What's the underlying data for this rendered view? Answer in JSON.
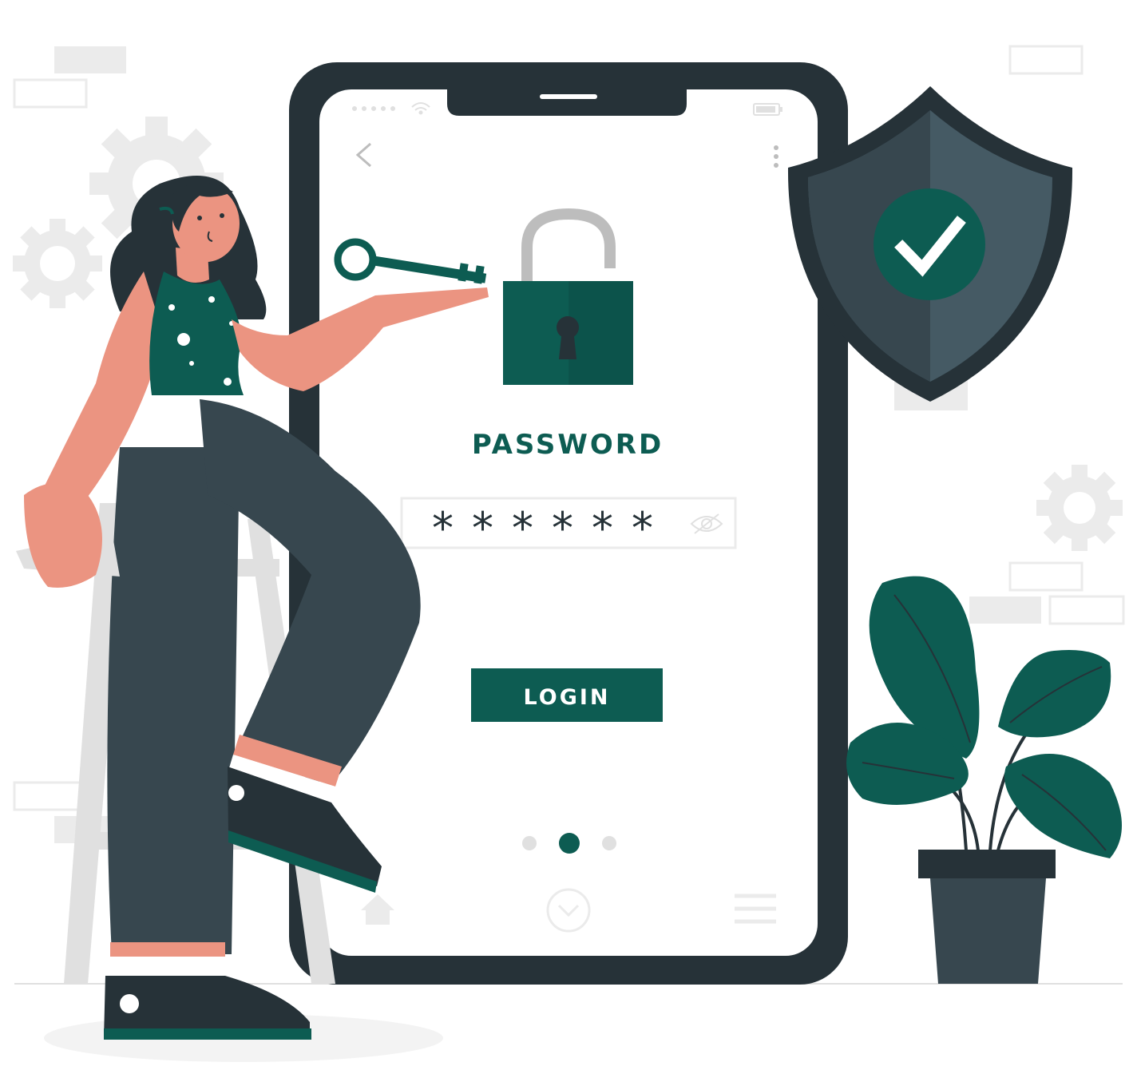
{
  "screen": {
    "title": "PASSWORD",
    "password_value": "******",
    "login_label": "LOGIN"
  },
  "pagination": {
    "total": 3,
    "active": 2
  },
  "icons": {
    "back": "chevron-left-icon",
    "menu": "more-vertical-icon",
    "reveal": "eye-slash-icon",
    "home": "home-icon",
    "nav_center": "chevron-down-circle-icon",
    "nav_menu": "hamburger-icon",
    "wifi": "wifi-icon",
    "battery": "battery-icon",
    "lock": "unlocked-padlock-icon",
    "key": "key-icon",
    "shield": "shield-check-icon"
  },
  "colors": {
    "accent": "#0d5c52",
    "dark": "#263238",
    "skin": "#eb9481",
    "pants": "#37474f",
    "shield": "#455a64"
  }
}
